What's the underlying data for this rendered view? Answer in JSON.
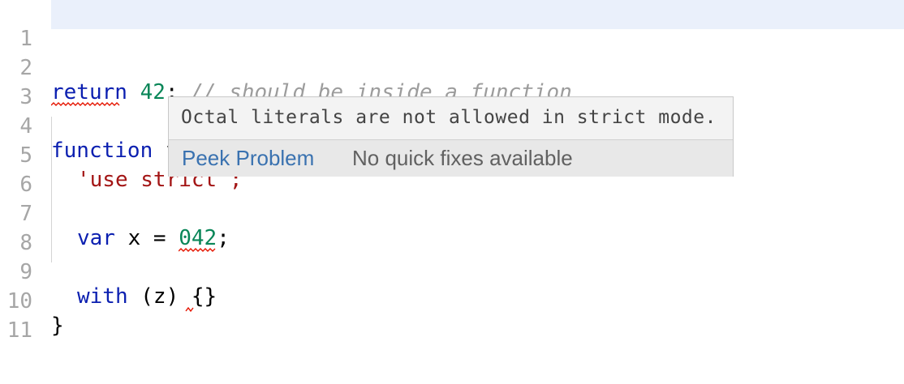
{
  "editor": {
    "lines": [
      {
        "number": "1"
      },
      {
        "number": "2",
        "keyword": "return",
        "value": "42",
        "punct": ";",
        "comment": "// should be inside a function"
      },
      {
        "number": "3"
      },
      {
        "number": "4",
        "keyword": "function",
        "rest": " f() {"
      },
      {
        "number": "5",
        "string": "'use strict';"
      },
      {
        "number": "6"
      },
      {
        "number": "7",
        "keyword": "var",
        "mid": " x = ",
        "value": "042",
        "punct": ";"
      },
      {
        "number": "8"
      },
      {
        "number": "9",
        "keyword": "with",
        "mid": " (z) ",
        "rest": "{}"
      },
      {
        "number": "10",
        "rest": "}"
      },
      {
        "number": "11"
      }
    ]
  },
  "hover": {
    "message": "Octal literals are not allowed in strict mode.",
    "peek_label": "Peek Problem",
    "no_fix_label": "No quick fixes available"
  },
  "colors": {
    "keyword": "#0b1fb0",
    "number": "#098658",
    "string": "#a31515",
    "comment": "#9c9c9c",
    "error_squiggle": "#e51400",
    "link": "#3a72b0"
  }
}
